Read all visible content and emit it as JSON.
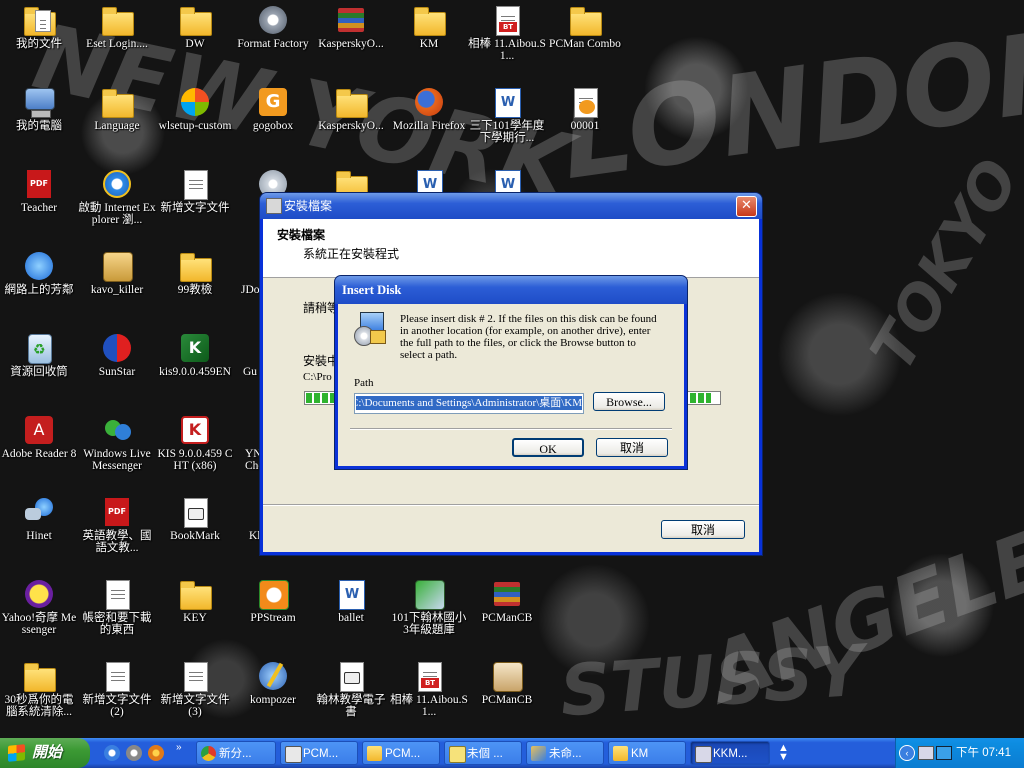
{
  "desktop_icons": [
    {
      "label": "我的文件",
      "icon": "my-documents-icon"
    },
    {
      "label": "Eset Login....",
      "icon": "folder-icon"
    },
    {
      "label": "DW",
      "icon": "folder-icon"
    },
    {
      "label": "Format Factory",
      "icon": "format-factory-icon"
    },
    {
      "label": "KasperskyO...",
      "icon": "winrar-icon"
    },
    {
      "label": "KM",
      "icon": "folder-icon"
    },
    {
      "label": "相棒 11.Aibou.S1...",
      "icon": "bt-torrent-icon"
    },
    {
      "label": "PCMan Combo",
      "icon": "folder-icon"
    },
    {
      "label": "我的電腦",
      "icon": "my-computer-icon"
    },
    {
      "label": "Language",
      "icon": "folder-icon"
    },
    {
      "label": "wlsetup-custom",
      "icon": "windows-live-setup-icon"
    },
    {
      "label": "gogobox",
      "icon": "gogobox-icon"
    },
    {
      "label": "KasperskyO...",
      "icon": "folder-icon"
    },
    {
      "label": "Mozilla Firefox",
      "icon": "firefox-icon"
    },
    {
      "label": "三下101學年度下學期行...",
      "icon": "word-document-icon"
    },
    {
      "label": "00001",
      "icon": "bmp-file-icon"
    },
    {
      "label": "Teacher",
      "icon": "pdf-icon"
    },
    {
      "label": "啟動 Internet Explorer 瀏...",
      "icon": "internet-explorer-icon"
    },
    {
      "label": "新增文字文件",
      "icon": "text-document-icon"
    },
    {
      "label": "網路上的芳鄰",
      "icon": "network-places-icon"
    },
    {
      "label": "kavo_killer",
      "icon": "package-icon"
    },
    {
      "label": "99教檢",
      "icon": "folder-icon"
    },
    {
      "label": "資源回收筒",
      "icon": "recycle-bin-icon"
    },
    {
      "label": "SunStar",
      "icon": "sunstar-icon"
    },
    {
      "label": "kis9.0.0.459EN",
      "icon": "kaspersky-installer-icon"
    },
    {
      "label": "Adobe Reader 8",
      "icon": "adobe-reader-icon"
    },
    {
      "label": "Windows Live Messenger",
      "icon": "messenger-icon"
    },
    {
      "label": "KIS 9.0.0.459 CHT (x86)",
      "icon": "kaspersky-icon"
    },
    {
      "label": "Hinet",
      "icon": "hinet-icon"
    },
    {
      "label": "英語教學、國語文教...",
      "icon": "pdf-icon"
    },
    {
      "label": "BookMark",
      "icon": "bookmark-file-icon"
    },
    {
      "label": "Yahoo!奇摩 Messenger",
      "icon": "yahoo-messenger-icon"
    },
    {
      "label": "帳密和要下載的東西",
      "icon": "text-document-icon"
    },
    {
      "label": "KEY",
      "icon": "folder-icon"
    },
    {
      "label": "PPStream",
      "icon": "ppstream-icon"
    },
    {
      "label": "ballet",
      "icon": "word-document-icon"
    },
    {
      "label": "101下翰林國小3年級題庫",
      "icon": "installer-icon"
    },
    {
      "label": "PCManCB",
      "icon": "winrar-icon"
    },
    {
      "label": "30秒爲你的電腦系統清除...",
      "icon": "folder-icon"
    },
    {
      "label": "新增文字文件 (2)",
      "icon": "text-document-icon"
    },
    {
      "label": "新增文字文件 (3)",
      "icon": "text-document-icon"
    },
    {
      "label": "kompozer",
      "icon": "kompozer-icon"
    },
    {
      "label": "翰林教學電子書",
      "icon": "bookmark-file-icon"
    },
    {
      "label": "相棒 11.Aibou.S1...",
      "icon": "bt-torrent-icon"
    },
    {
      "label": "PCManCB",
      "icon": "setup-icon"
    }
  ],
  "partial_icons": {
    "jdo": "JDo",
    "gu": "Gu",
    "yn_che": "YN Che",
    "kl": "Kl"
  },
  "install_dialog": {
    "title": "安裝檔案",
    "heading": "安裝檔案",
    "subheading": "系統正在安裝程式",
    "text1": "請稍等",
    "text2": "安裝中",
    "path_partial": "C:\\Pro",
    "progress": 0.98,
    "cancel_label": "取消"
  },
  "insert_disk_dialog": {
    "title": "Insert Disk",
    "message": "Please insert disk # 2.  If the files on this disk can be found in another location (for example, on another drive), enter the full path to the files, or click the Browse button to select a path.",
    "path_label": "Path",
    "path_value": "C:\\Documents and Settings\\Administrator\\桌面\\KM",
    "browse_label": "Browse...",
    "ok_label": "OK",
    "cancel_label": "取消"
  },
  "taskbar": {
    "start_label": "開始",
    "buttons": [
      {
        "label": "新分...",
        "icon": "chrome-icon",
        "active": false
      },
      {
        "label": "PCM...",
        "icon": "pcman-icon",
        "active": false
      },
      {
        "label": "PCM...",
        "icon": "folder-icon",
        "active": false
      },
      {
        "label": "未個 ...",
        "icon": "sticky-note-icon",
        "active": false
      },
      {
        "label": "未命...",
        "icon": "paint-icon",
        "active": false
      },
      {
        "label": "KM",
        "icon": "folder-icon",
        "active": false
      },
      {
        "label": "KKM...",
        "icon": "installer-icon",
        "active": true
      }
    ],
    "clock": "下午 07:41"
  },
  "colors": {
    "xp_blue": "#0831d9",
    "taskbar_blue": "#245edb",
    "start_green": "#3c9a34",
    "dialog_bg": "#ece9d8"
  }
}
